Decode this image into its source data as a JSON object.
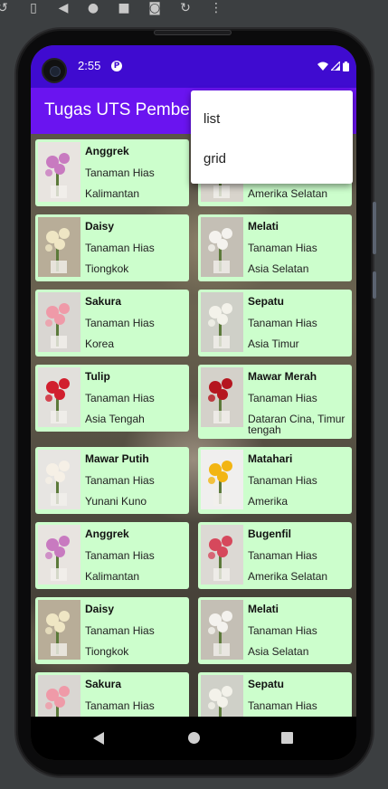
{
  "emulator_toolbar": {
    "icons": [
      "rotate-icon",
      "device-frame-icon",
      "back-icon",
      "home-icon",
      "overview-icon",
      "camera-icon",
      "replay-icon",
      "more-icon"
    ]
  },
  "status_bar": {
    "time": "2:55",
    "app_badge": "P",
    "icons": [
      "wifi-icon",
      "signal-icon",
      "battery-icon"
    ]
  },
  "app_bar": {
    "title": "Tugas UTS Pemberdayaan"
  },
  "overflow_menu": {
    "items": [
      {
        "label": "list"
      },
      {
        "label": "grid"
      }
    ]
  },
  "flowers": [
    {
      "name": "Anggrek",
      "type": "Tanaman Hias",
      "origin": "Kalimantan"
    },
    {
      "name": "",
      "type": "",
      "origin": "Amerika Selatan"
    },
    {
      "name": "Daisy",
      "type": "Tanaman Hias",
      "origin": "Tiongkok"
    },
    {
      "name": "Melati",
      "type": "Tanaman Hias",
      "origin": "Asia Selatan"
    },
    {
      "name": "Sakura",
      "type": "Tanaman Hias",
      "origin": "Korea"
    },
    {
      "name": "Sepatu",
      "type": "Tanaman Hias",
      "origin": "Asia Timur"
    },
    {
      "name": "Tulip",
      "type": "Tanaman Hias",
      "origin": "Asia Tengah"
    },
    {
      "name": "Mawar Merah",
      "type": "Tanaman Hias",
      "origin": "Dataran Cina, Timur tengah"
    },
    {
      "name": "Mawar Putih",
      "type": "Tanaman Hias",
      "origin": "Yunani Kuno"
    },
    {
      "name": "Matahari",
      "type": "Tanaman Hias",
      "origin": "Amerika"
    },
    {
      "name": "Anggrek",
      "type": "Tanaman Hias",
      "origin": "Kalimantan"
    },
    {
      "name": "Bugenfil",
      "type": "Tanaman Hias",
      "origin": "Amerika Selatan"
    },
    {
      "name": "Daisy",
      "type": "Tanaman Hias",
      "origin": "Tiongkok"
    },
    {
      "name": "Melati",
      "type": "Tanaman Hias",
      "origin": "Asia Selatan"
    },
    {
      "name": "Sakura",
      "type": "Tanaman Hias",
      "origin": ""
    },
    {
      "name": "Sepatu",
      "type": "Tanaman Hias",
      "origin": ""
    }
  ],
  "colors": {
    "status_bar": "#3f0bd0",
    "app_bar": "#6a14f0",
    "card": "#ccfecc"
  }
}
